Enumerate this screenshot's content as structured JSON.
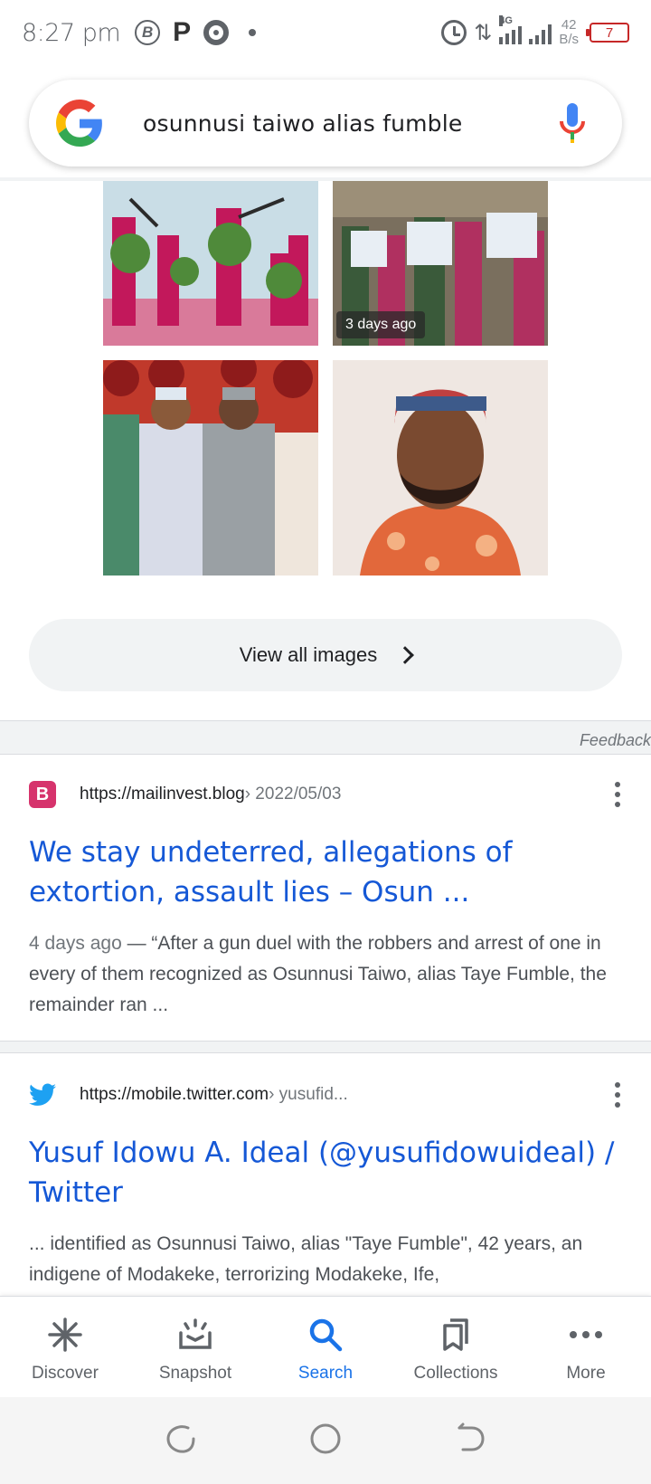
{
  "status_bar": {
    "time": "8:27 pm",
    "network_type": "4G",
    "speed_value": "42",
    "speed_unit": "B/s",
    "battery": "7"
  },
  "search": {
    "query": "osunnusi taiwo alias fumble"
  },
  "images": {
    "badge": "3 days ago",
    "view_all_label": "View all images"
  },
  "feedback_label": "Feedback",
  "results": [
    {
      "favicon": "B",
      "url": "https://mailinvest.blog",
      "crumb": " › 2022/05/03",
      "title": "We stay undeterred, allegations of extortion, assault lies – Osun ...",
      "date": "4 days ago",
      "snippet": " — “After a gun duel with the robbers and arrest of one in every of them recognized as Osunnusi Taiwo, alias Taye Fumble, the remainder ran ..."
    },
    {
      "favicon": "twitter-bird-icon",
      "url": "https://mobile.twitter.com",
      "crumb": " › yusufid...",
      "title": "Yusuf Idowu A. Ideal (@yusufidowuideal) / Twitter",
      "snippet": "... identified as Osunnusi Taiwo, alias \"Taye Fumble\", 42 years, an indigene of Modakeke, terrorizing Modakeke, Ife,"
    }
  ],
  "bottom_nav": [
    {
      "label": "Discover",
      "icon": "asterisk-icon"
    },
    {
      "label": "Snapshot",
      "icon": "snapshot-icon"
    },
    {
      "label": "Search",
      "icon": "search-icon",
      "active": true
    },
    {
      "label": "Collections",
      "icon": "bookmarks-icon"
    },
    {
      "label": "More",
      "icon": "more-horiz-icon"
    }
  ],
  "colors": {
    "link": "#1558d6",
    "active": "#1a73e8",
    "text": "#202124",
    "muted": "#70757a"
  }
}
